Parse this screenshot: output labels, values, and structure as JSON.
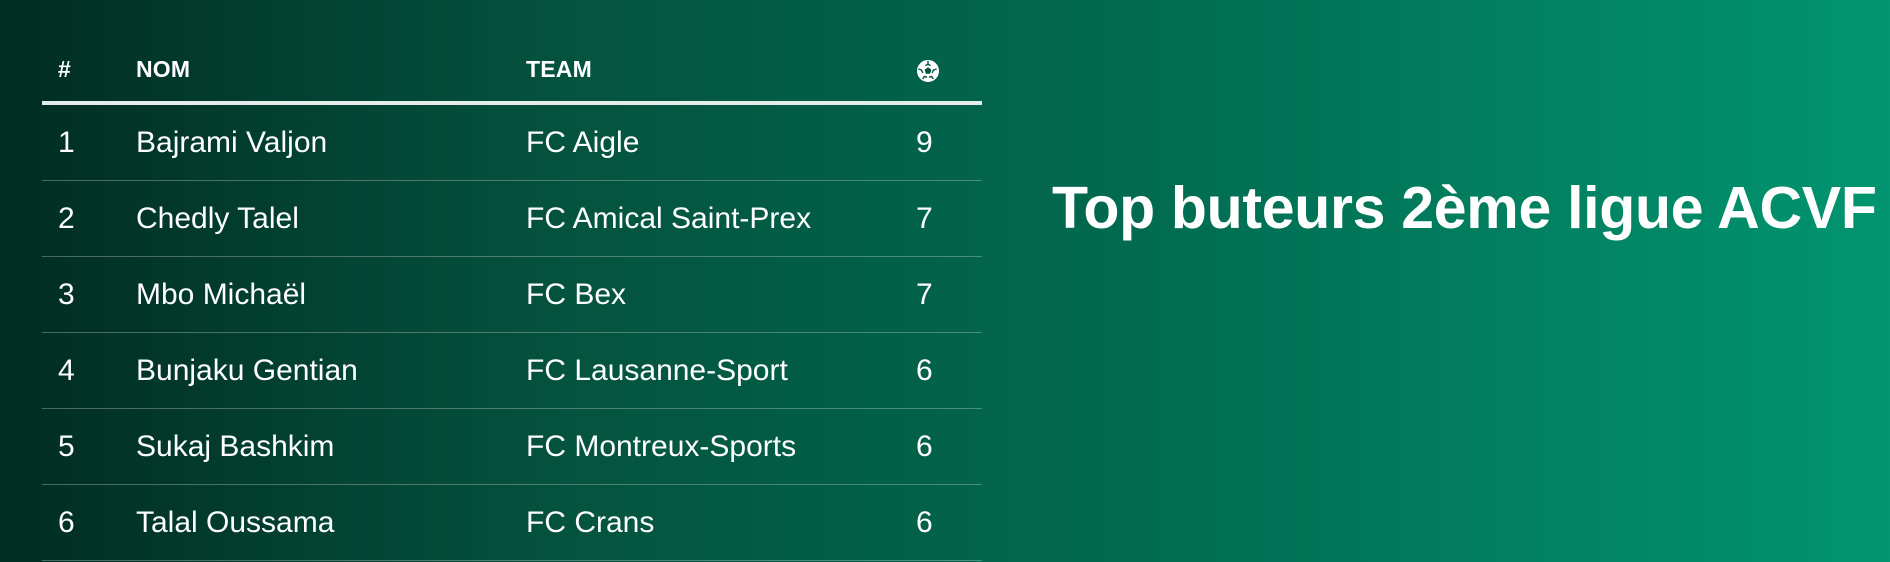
{
  "title": "Top buteurs 2ème ligue ACVF",
  "table": {
    "headers": {
      "rank": "#",
      "name": "NOM",
      "team": "TEAM",
      "goals_icon": "soccer-ball-icon"
    },
    "rows": [
      {
        "rank": "1",
        "name": "Bajrami Valjon",
        "team": "FC Aigle",
        "goals": "9"
      },
      {
        "rank": "2",
        "name": "Chedly Talel",
        "team": "FC Amical Saint-Prex",
        "goals": "7"
      },
      {
        "rank": "3",
        "name": "Mbo Michaël",
        "team": "FC Bex",
        "goals": "7"
      },
      {
        "rank": "4",
        "name": "Bunjaku Gentian",
        "team": "FC Lausanne-Sport",
        "goals": "6"
      },
      {
        "rank": "5",
        "name": "Sukaj Bashkim",
        "team": "FC Montreux-Sports",
        "goals": "6"
      },
      {
        "rank": "6",
        "name": "Talal Oussama",
        "team": "FC Crans",
        "goals": "6"
      }
    ]
  },
  "colors": {
    "background_left": "#012c21",
    "background_right": "#029570",
    "text": "#ffffff",
    "header_rule": "#e6ece9"
  }
}
